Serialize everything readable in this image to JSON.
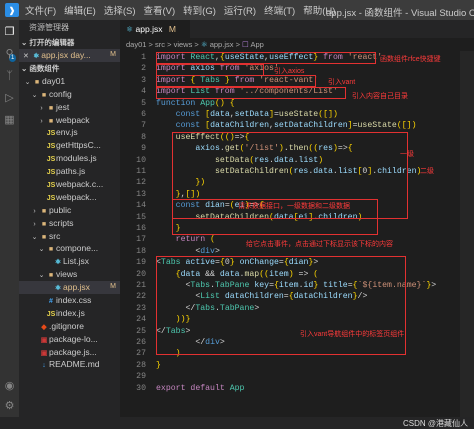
{
  "titlebar": {
    "menus": [
      "文件(F)",
      "编辑(E)",
      "选择(S)",
      "查看(V)",
      "转到(G)",
      "运行(R)",
      "终端(T)",
      "帮助(H)"
    ],
    "window_title": "app.jsx - 函数组件 - Visual Studio Code"
  },
  "activity": {
    "badge": "1"
  },
  "sidebar": {
    "header": "资源管理器",
    "open_editors_label": "打开的编辑器",
    "open_file": "app.jsx day...",
    "open_file_status": "M",
    "workspace_label": "函数组件",
    "tree": [
      {
        "name": "day01",
        "type": "folder",
        "depth": 0,
        "open": true
      },
      {
        "name": "config",
        "type": "folder",
        "depth": 1,
        "open": true
      },
      {
        "name": "jest",
        "type": "folder",
        "depth": 2,
        "open": false
      },
      {
        "name": "webpack",
        "type": "folder",
        "depth": 2,
        "open": false
      },
      {
        "name": "env.js",
        "type": "js",
        "depth": 2
      },
      {
        "name": "getHttpsC...",
        "type": "js",
        "depth": 2
      },
      {
        "name": "modules.js",
        "type": "js",
        "depth": 2
      },
      {
        "name": "paths.js",
        "type": "js",
        "depth": 2
      },
      {
        "name": "webpack.c...",
        "type": "js",
        "depth": 2
      },
      {
        "name": "webpack...",
        "type": "js",
        "depth": 2
      },
      {
        "name": "public",
        "type": "folder",
        "depth": 1,
        "open": false
      },
      {
        "name": "scripts",
        "type": "folder",
        "depth": 1,
        "open": false
      },
      {
        "name": "src",
        "type": "folder",
        "depth": 1,
        "open": true
      },
      {
        "name": "compone...",
        "type": "folder",
        "depth": 2,
        "open": true
      },
      {
        "name": "List.jsx",
        "type": "react",
        "depth": 3
      },
      {
        "name": "views",
        "type": "folder",
        "depth": 2,
        "open": true
      },
      {
        "name": "app.jsx",
        "type": "react",
        "depth": 3,
        "selected": true,
        "status": "M"
      },
      {
        "name": "index.css",
        "type": "css",
        "depth": 2
      },
      {
        "name": "index.js",
        "type": "js",
        "depth": 2
      },
      {
        "name": ".gitignore",
        "type": "git",
        "depth": 1
      },
      {
        "name": "package-lo...",
        "type": "npm",
        "depth": 1
      },
      {
        "name": "package.js...",
        "type": "npm",
        "depth": 1
      },
      {
        "name": "README.md",
        "type": "md",
        "depth": 1
      }
    ]
  },
  "editor": {
    "tab_label": "app.jsx",
    "tab_status": "M",
    "breadcrumb": [
      "day01",
      "src",
      "views",
      "app.jsx",
      "App"
    ],
    "lines": [
      "import React,{useState,useEffect} from 'react'",
      "import axios from 'axios'",
      "import { Tabs } from 'react-vant'",
      "import List from '../components/List'",
      "function App() {",
      "    const [data,setData]=useState([])",
      "    const [dataChildren,setDataChildren]=useState([])",
      "    useEffect(()=>{",
      "        axios.get('/list').then((res)=>{",
      "            setData(res.data.list)",
      "            setDataChildren(res.data.list[0].children)",
      "        })",
      "    },[])",
      "    const dian=(ei)=>{",
      "        setDataChildren(data[ei].children)",
      "    }",
      "    return (",
      "        <div>",
      "<Tabs active={0} onChange={dian}>",
      "    {data && data.map((item) => (",
      "      <Tabs.TabPane key={item.id} title={`${item.name}`}>",
      "        <List dataChildren={dataChildren}/>",
      "      </Tabs.TabPane>",
      "    ))}",
      "</Tabs>",
      "        </div>",
      "    )",
      "}",
      "",
      "export default App"
    ]
  },
  "annotations": [
    "函数组件rfce快捷键",
    "引入axios",
    "引入vant",
    "引入内容自己目录",
    "二级",
    "一级",
    "请求数据接口，一级数据和二级数据",
    "给它点击事件，点击通过下标显示该下标的内容",
    "引入vant导航组件中的标签页组件"
  ],
  "watermark": "CSDN @港藏仙人"
}
